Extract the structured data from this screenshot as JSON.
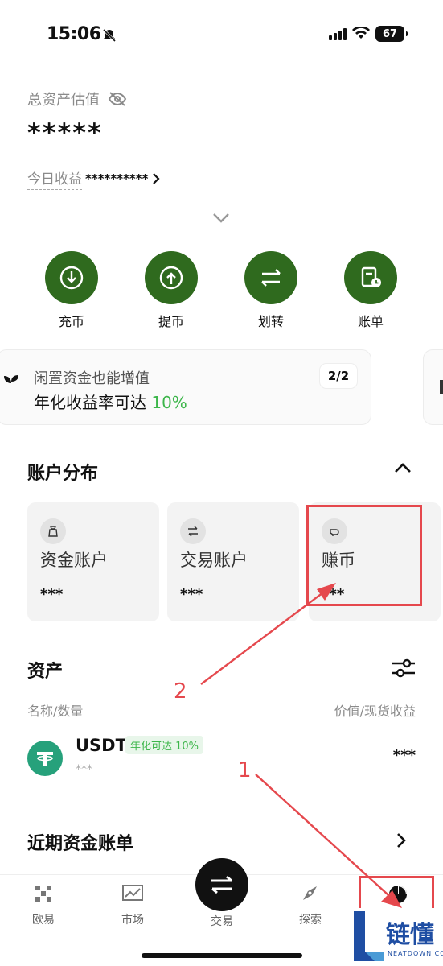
{
  "status_bar": {
    "time": "15:06",
    "battery": "67"
  },
  "total_assets": {
    "label": "总资产估值",
    "value": "*****"
  },
  "today_earnings": {
    "label": "今日收益",
    "value": "**********"
  },
  "actions": [
    {
      "label": "充币",
      "icon": "deposit-icon"
    },
    {
      "label": "提币",
      "icon": "withdraw-icon"
    },
    {
      "label": "划转",
      "icon": "transfer-icon"
    },
    {
      "label": "账单",
      "icon": "bill-icon"
    }
  ],
  "promo": {
    "line1": "闲置资金也能增值",
    "line2_prefix": "年化收益率可达 ",
    "line2_highlight": "10%",
    "page": "2/2"
  },
  "account_section": {
    "title": "账户分布",
    "cards": [
      {
        "name": "资金账户",
        "value": "***",
        "icon": "bag-icon"
      },
      {
        "name": "交易账户",
        "value": "***",
        "icon": "swap-icon"
      },
      {
        "name": "赚币",
        "value": "***",
        "icon": "piggy-icon"
      }
    ]
  },
  "assets_section": {
    "title": "资产",
    "col_left": "名称/数量",
    "col_right": "价值/现货收益",
    "rows": [
      {
        "symbol": "USDT",
        "tag": "年化可达 10%",
        "amount": "***",
        "value": "***"
      }
    ]
  },
  "recent_bills": {
    "title": "近期资金账单"
  },
  "bottom_nav": [
    {
      "label": "欧易",
      "icon": "okx-logo-icon"
    },
    {
      "label": "市场",
      "icon": "chart-icon"
    },
    {
      "label": "交易",
      "icon": "trade-icon"
    },
    {
      "label": "探索",
      "icon": "compass-icon"
    },
    {
      "label": "",
      "icon": "pie-chart-icon"
    }
  ],
  "annotations": {
    "step1": "1",
    "step2": "2"
  },
  "watermark": {
    "text": "链懂",
    "sub": "NEATDOWN.COM"
  },
  "colors": {
    "brand_green": "#2f6a1e",
    "accent_green": "#3cb64a",
    "annotation_red": "#e5484d"
  }
}
